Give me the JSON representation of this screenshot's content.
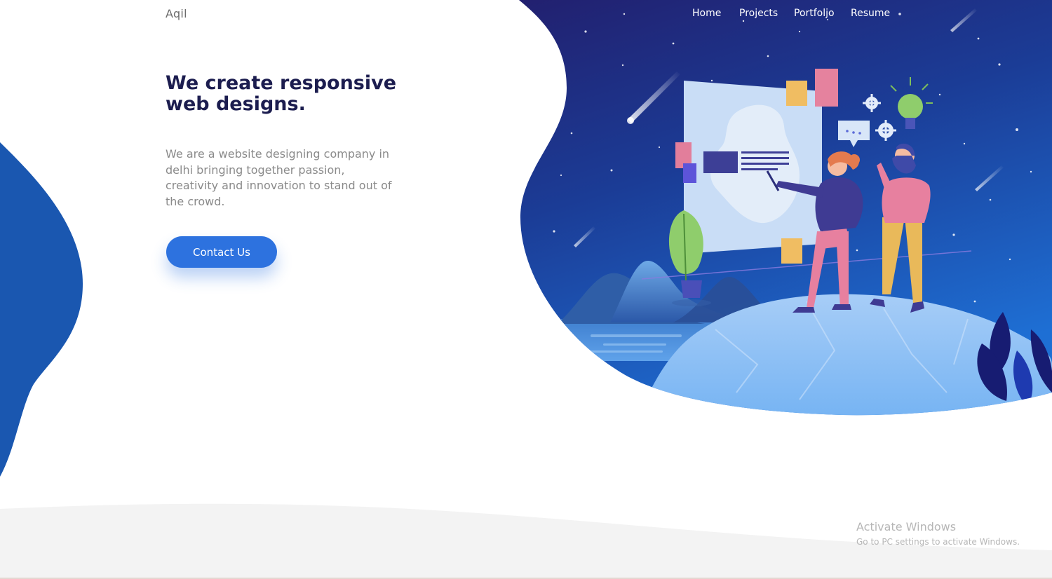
{
  "header": {
    "logo_text": "Aqil"
  },
  "nav": {
    "items": [
      {
        "label": "Home"
      },
      {
        "label": "Projects"
      },
      {
        "label": "Portfoljo"
      },
      {
        "label": "Resume"
      }
    ]
  },
  "hero": {
    "title": "We create responsive web designs.",
    "description": "We are a website designing company in delhi bringing together passion, creativity and innovation to stand out of the crowd.",
    "cta_label": "Contact Us"
  },
  "os_overlay": {
    "title": "Activate Windows",
    "subtitle": "Go to PC settings to activate Windows."
  },
  "colors": {
    "accent": "#2d72df",
    "heading": "#1c1d4f",
    "hero_bg_top": "#1b2f86",
    "hero_bg_bottom": "#1d6ad1",
    "left_blob": "#1a5ab6",
    "footer_band": "#f3f3f3"
  },
  "illustration": {
    "icons": [
      "lightbulb-icon",
      "gear-icon",
      "chat-bubble-icon",
      "plant-icon",
      "leaf-icon"
    ]
  }
}
